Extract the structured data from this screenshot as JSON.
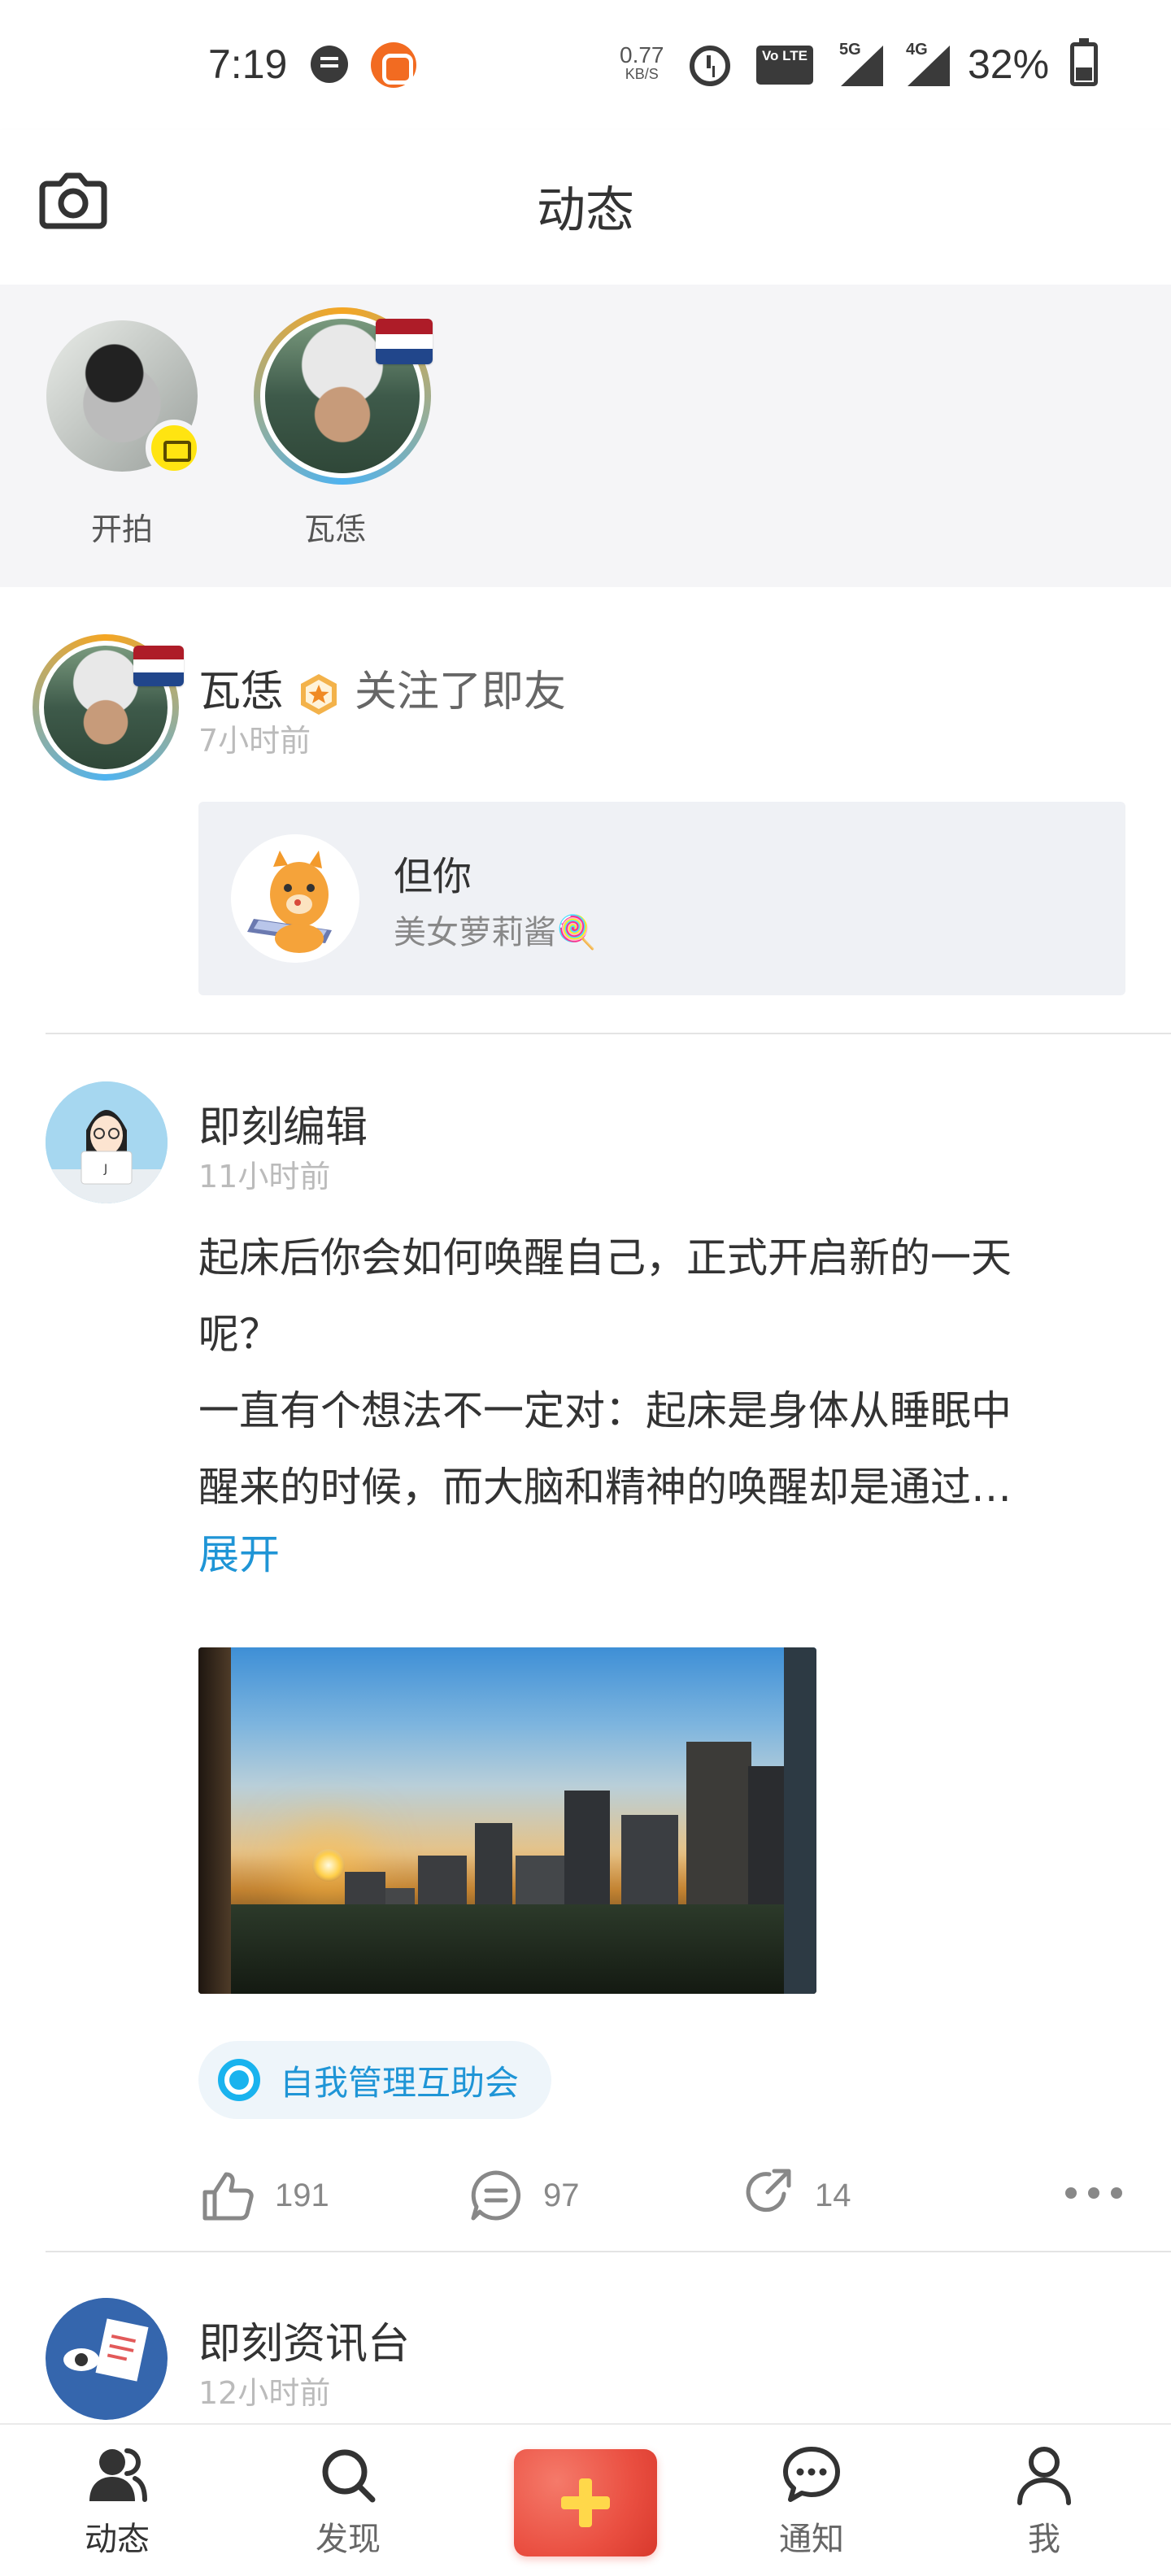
{
  "status_bar": {
    "time": "7:19",
    "net_speed_value": "0.77",
    "net_speed_unit": "KB/S",
    "volte_label": "Vo LTE",
    "signal1_tag": "5G",
    "signal2_tag": "4G",
    "battery_percent": "32%"
  },
  "header": {
    "title": "动态",
    "camera_icon": "camera-icon"
  },
  "stories": [
    {
      "label": "开拍",
      "badge_icon": "camera-icon"
    },
    {
      "label": "瓦恁",
      "flag": "netherlands"
    }
  ],
  "feed": [
    {
      "user": "瓦恁",
      "badge_icon": "hexagon-star-badge-icon",
      "action": "关注了即友",
      "time": "7小时前",
      "shared": {
        "title": "但你",
        "subtitle": "美女萝莉酱🍭"
      }
    },
    {
      "user": "即刻编辑",
      "time": "11小时前",
      "text_lines": [
        "起床后你会如何唤醒自己，正式开启新的一天",
        "呢？",
        "一直有个想法不一定对：起床是身体从睡眠中",
        "醒来的时候，而大脑和精神的唤醒却是通过…"
      ],
      "expand_label": "展开",
      "topic": "自我管理互助会",
      "likes": "191",
      "comments": "97",
      "shares": "14"
    },
    {
      "user": "即刻资讯台",
      "time": "12小时前"
    }
  ],
  "bottom_nav": [
    {
      "label": "动态",
      "icon": "people-icon",
      "active": true
    },
    {
      "label": "发现",
      "icon": "search-icon",
      "active": false
    },
    {
      "label": "",
      "icon": "plus-icon",
      "active": false
    },
    {
      "label": "通知",
      "icon": "chat-bubble-icon",
      "active": false
    },
    {
      "label": "我",
      "icon": "person-icon",
      "active": false
    }
  ],
  "colors": {
    "accent_blue": "#1f95d6",
    "publish_red": "#ea4f41",
    "camera_badge_yellow": "#ffe411"
  }
}
